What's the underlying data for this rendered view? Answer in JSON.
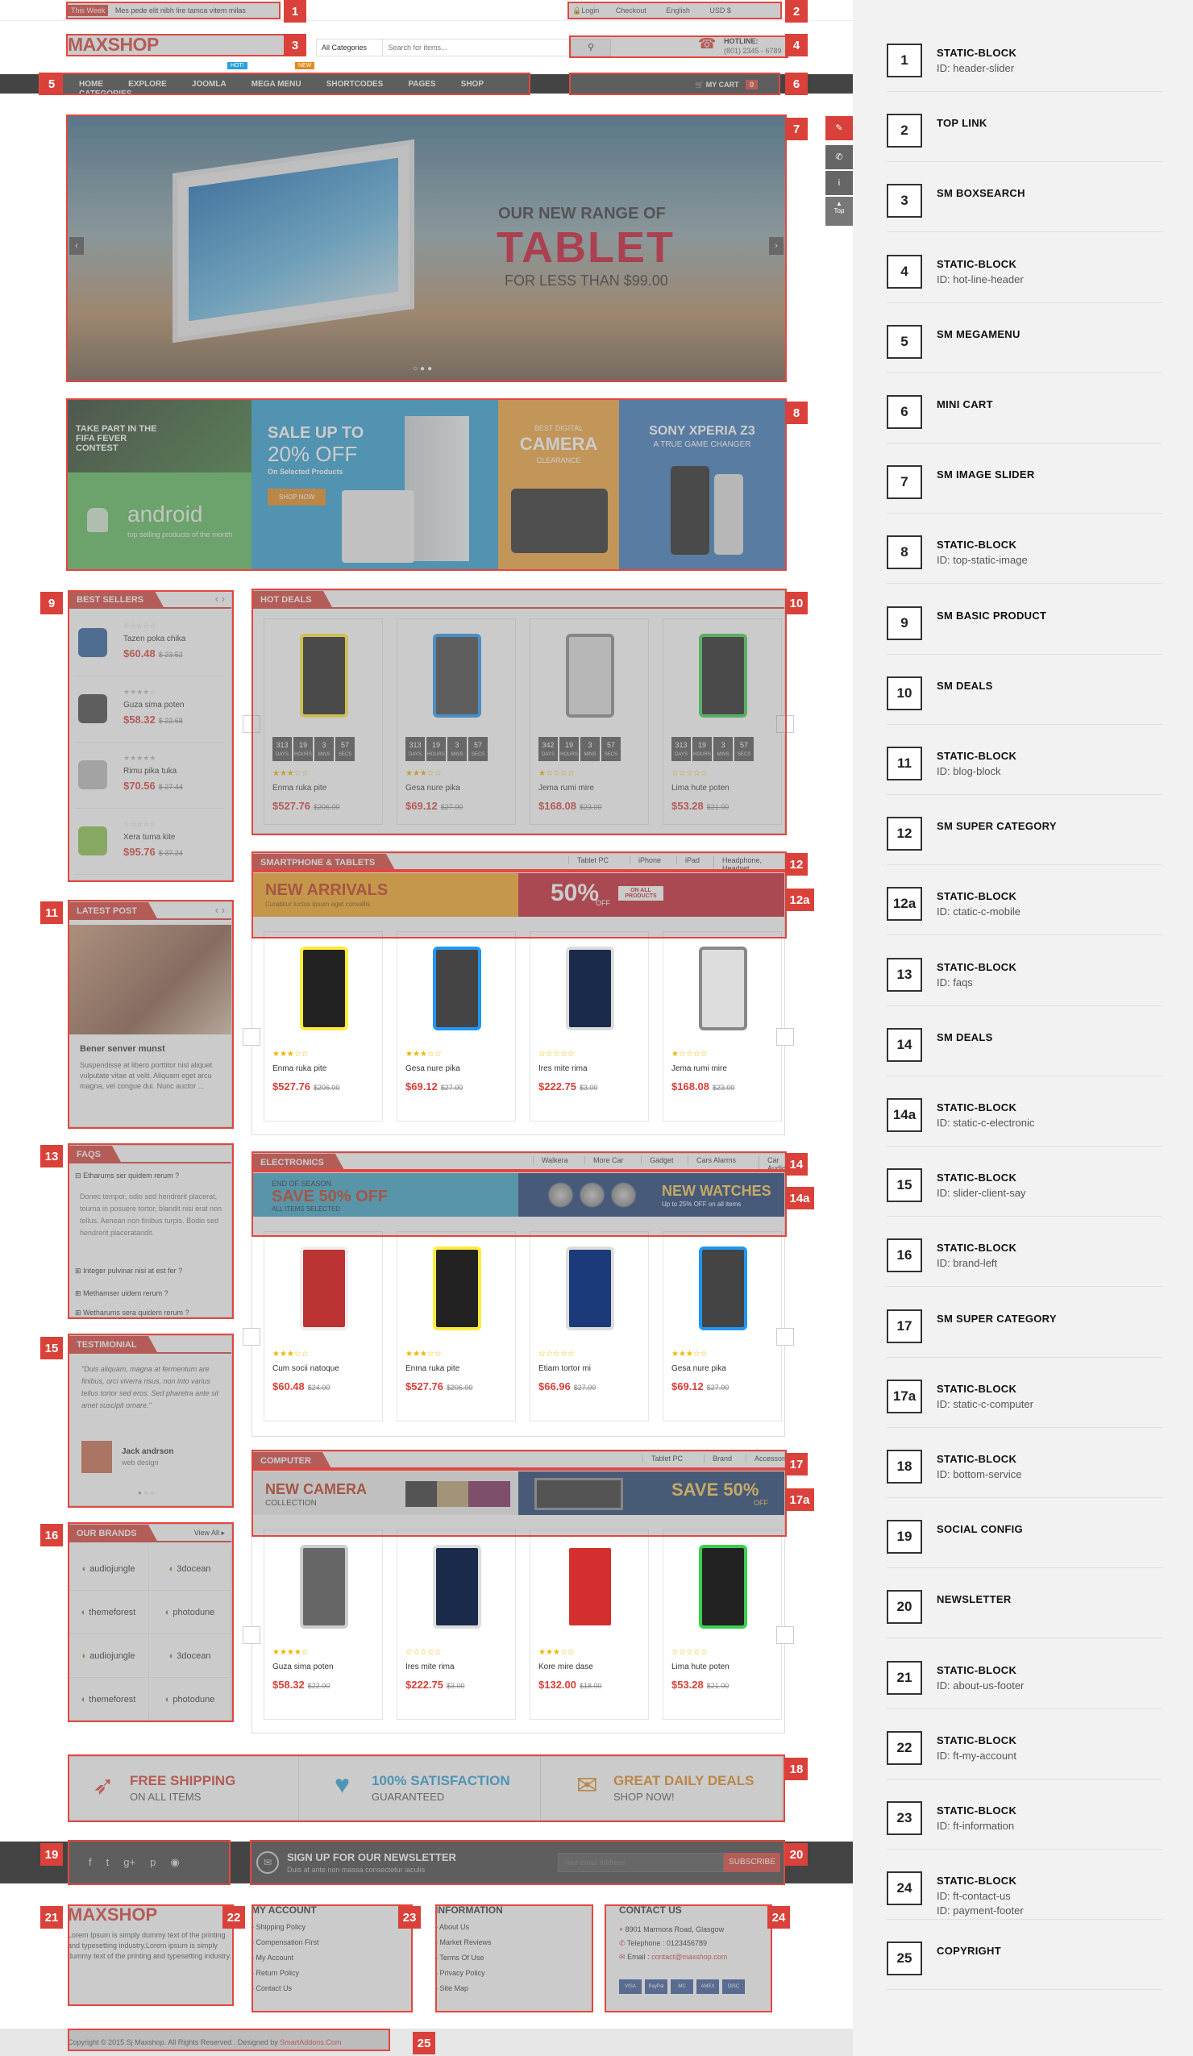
{
  "header": {
    "week_tag": "This Week",
    "week_text": "Mes pede elit nibh lire tamca vitem milas",
    "login": "Login",
    "checkout": "Checkout",
    "language": "English",
    "currency": "USD $",
    "logo": "MAXSHOP",
    "search_cat": "All Categories",
    "search_placeholder": "Search for items...",
    "hotline_label": "HOTLINE:",
    "hotline_number": "(801) 2345 - 6789"
  },
  "menu": {
    "items": [
      "HOME",
      "EXPLORE",
      "JOOMLA",
      "MEGA MENU",
      "SHORTCODES",
      "PAGES",
      "SHOP",
      "CATEGORIES"
    ],
    "hot": "HOT!",
    "new": "NEW",
    "cart": "MY CART",
    "cart_count": "0"
  },
  "slider": {
    "line1": "OUR NEW RANGE OF",
    "line2": "TABLET",
    "line3": "FOR LESS THAN $99.00"
  },
  "banners": {
    "fifa": "TAKE PART IN THE FIFA FEVER CONTEST",
    "android": "android",
    "android_sub": "top selling products of the month",
    "sale1": "SALE UP TO",
    "sale2": "20% OFF",
    "sale3": "On Selected Products",
    "shop_now": "SHOP NOW",
    "cam_top": "BEST DIGITAL",
    "cam": "CAMERA",
    "cam_sub": "CLEARANCE",
    "sony": "SONY XPERIA Z3",
    "sony_sub": "A TRUE GAME CHANGER"
  },
  "best_sellers": {
    "title": "BEST SELLERS",
    "items": [
      {
        "name": "Tazen poka chika",
        "price": "$60.48",
        "old": "$ 23.52",
        "stars": "☆☆☆☆☆"
      },
      {
        "name": "Guza sima poten",
        "price": "$58.32",
        "old": "$ 22.68",
        "stars": "★★★★☆"
      },
      {
        "name": "Rimu pika tuka",
        "price": "$70.56",
        "old": "$ 27.44",
        "stars": "★★★★★"
      },
      {
        "name": "Xera tuma kite",
        "price": "$95.76",
        "old": "$ 37.24",
        "stars": "☆☆☆☆☆"
      }
    ]
  },
  "hot_deals": {
    "title": "HOT DEALS",
    "labels": [
      "DAYS",
      "HOURS",
      "MINS",
      "SECS"
    ],
    "items": [
      {
        "name": "Enma ruka pite",
        "price": "$527.76",
        "old": "$206.00",
        "cd": [
          "313",
          "19",
          "3",
          "57"
        ],
        "stars": "★★★☆☆"
      },
      {
        "name": "Gesa nure pika",
        "price": "$69.12",
        "old": "$27.00",
        "cd": [
          "313",
          "19",
          "3",
          "57"
        ],
        "stars": "★★★☆☆"
      },
      {
        "name": "Jema rumi mire",
        "price": "$168.08",
        "old": "$23.00",
        "cd": [
          "342",
          "19",
          "3",
          "57"
        ],
        "stars": "★☆☆☆☆"
      },
      {
        "name": "Lima hute poten",
        "price": "$53.28",
        "old": "$21.00",
        "cd": [
          "313",
          "19",
          "3",
          "57"
        ],
        "stars": "☆☆☆☆☆"
      }
    ]
  },
  "smartphone": {
    "title": "SMARTPHONE & TABLETS",
    "tabs": [
      "Tablet PC",
      "iPhone",
      "iPad",
      "Headphone, Headset"
    ],
    "banner_left": "NEW ARRIVALS",
    "banner_left_sub": "Curabitur luctus ipsum eget convallis",
    "banner_pct": "50%",
    "banner_off": "OFF",
    "banner_on": "ON ALL PRODUCTS",
    "items": [
      {
        "name": "Enma ruka pite",
        "price": "$527.76",
        "old": "$206.00",
        "stars": "★★★☆☆"
      },
      {
        "name": "Gesa nure pika",
        "price": "$69.12",
        "old": "$27.00",
        "stars": "★★★☆☆"
      },
      {
        "name": "Ires mite rima",
        "price": "$222.75",
        "old": "$3.00",
        "stars": "☆☆☆☆☆"
      },
      {
        "name": "Jema rumi mire",
        "price": "$168.08",
        "old": "$23.00",
        "stars": "★☆☆☆☆"
      }
    ]
  },
  "latest_post": {
    "title": "LATEST POST",
    "post_title": "Bener senver munst",
    "post_text": "Suspendisse at libero porttitor nisl aliquet vulputate vitae at velit. Aliquam eget arcu magna, vel congue dui. Nunc auctor ..."
  },
  "faqs": {
    "title": "FAQS",
    "q1": "Etharums ser quidem rerum ?",
    "a1": "Donec tempor, odio sed hendrerit placerat, tourna in posuere tortor, blandit nisi erat non tellus. Aenean non finibus turpis. Bodio sed hendrerit placeratandit.",
    "q2": "Integer pulvinar nisi at est fer ?",
    "q3": "Methamser uidem rerum ?",
    "q4": "Wetharums sera quidem rerum ?"
  },
  "electronics": {
    "title": "ELECTRONICS",
    "tabs": [
      "Walkera",
      "More Car",
      "Gadget",
      "Cars Alarms",
      "Car Audio"
    ],
    "b1_top": "END OF SEASON",
    "b1_main": "SAVE 50% OFF",
    "b1_sub": "ALL ITEMS SELECTED",
    "b2_main": "NEW WATCHES",
    "b2_sub": "Up to 25% OFF on all items",
    "items": [
      {
        "name": "Cum socii natoque",
        "price": "$60.48",
        "old": "$24.00",
        "stars": "★★★☆☆"
      },
      {
        "name": "Enma ruka pite",
        "price": "$527.76",
        "old": "$206.00",
        "stars": "★★★☆☆"
      },
      {
        "name": "Etiam tortor mi",
        "price": "$66.96",
        "old": "$27.00",
        "stars": "☆☆☆☆☆"
      },
      {
        "name": "Gesa nure pika",
        "price": "$69.12",
        "old": "$27.00",
        "stars": "★★★☆☆"
      }
    ]
  },
  "testimonial": {
    "title": "TESTIMONIAL",
    "quote": "\"Duis aliquam, magna at fermentum are finibus, orci viverra risus, non into varius tellus tortor sed eros. Sed pharetra ante sit amet suscipit ornare.\"",
    "author": "Jack andrson",
    "role": "web design"
  },
  "computer": {
    "title": "COMPUTER",
    "tabs": [
      "Tablet PC",
      "Brand",
      "Accessories"
    ],
    "b1": "NEW CAMERA",
    "b1_sub": "COLLECTION",
    "b2": "SAVE 50%",
    "b2_off": "OFF",
    "items": [
      {
        "name": "Guza sima poten",
        "price": "$58.32",
        "old": "$22.00",
        "stars": "★★★★☆"
      },
      {
        "name": "Ires mite rima",
        "price": "$222.75",
        "old": "$3.00",
        "stars": "☆☆☆☆☆"
      },
      {
        "name": "Kore mire dase",
        "price": "$132.00",
        "old": "$18.00",
        "stars": "★★★☆☆"
      },
      {
        "name": "Lima hute poten",
        "price": "$53.28",
        "old": "$21.00",
        "stars": "☆☆☆☆☆"
      }
    ]
  },
  "brands": {
    "title": "OUR BRANDS",
    "view_all": "View All",
    "items": [
      "audiojungle",
      "3docean",
      "themeforest",
      "photodune",
      "audiojungle",
      "3docean",
      "themeforest",
      "photodune"
    ]
  },
  "service": [
    {
      "title": "FREE SHIPPING",
      "sub": "ON ALL ITEMS",
      "color": "#d8403a"
    },
    {
      "title": "100% SATISFACTION",
      "sub": "GUARANTEED",
      "color": "#2aa0d8"
    },
    {
      "title": "GREAT DAILY DEALS",
      "sub": "SHOP NOW!",
      "color": "#e28a1f"
    }
  ],
  "newsletter": {
    "title": "SIGN UP FOR OUR NEWSLETTER",
    "sub": "Duis at ante non massa consectetur iaculis",
    "placeholder": "Your email address",
    "button": "SUBSCRIBE"
  },
  "footer": {
    "about_logo": "MAXSHOP",
    "about_text": "Lorem Ipsum is simply dummy text of the printing and typesetting industry.Lorem ipsum is simply dummy text of the printing and typesetting industry.",
    "my_account": "MY ACCOUNT",
    "my_account_links": [
      "Shipping Policy",
      "Compensation First",
      "My Account",
      "Return Policy",
      "Contact Us"
    ],
    "information": "INFORMATION",
    "information_links": [
      "About Us",
      "Market Reviews",
      "Terms Of Use",
      "Privacy Policy",
      "Site Map"
    ],
    "contact": "CONTACT US",
    "address": "8901 Marmora Road, Glasgow",
    "phone": "Telephone : 0123456789",
    "email_label": "Email :",
    "email": "contact@maxshop.com",
    "payments": [
      "VISA",
      "PayPal",
      "MC",
      "AMEX",
      "DISC"
    ],
    "copyright": "Copyright © 2015 Sj Maxshop. All Rights Reserved . Designed by",
    "designer": "SmartAddons.Com"
  },
  "tools": {
    "top": "Top"
  },
  "legend": [
    {
      "n": "1",
      "t": "STATIC-BLOCK",
      "s": "ID: header-slider"
    },
    {
      "n": "2",
      "t": "TOP LINK",
      "s": ""
    },
    {
      "n": "3",
      "t": "SM BOXSEARCH",
      "s": ""
    },
    {
      "n": "4",
      "t": "STATIC-BLOCK",
      "s": "ID: hot-line-header"
    },
    {
      "n": "5",
      "t": "SM MEGAMENU",
      "s": ""
    },
    {
      "n": "6",
      "t": "MINI CART",
      "s": ""
    },
    {
      "n": "7",
      "t": "SM IMAGE SLIDER",
      "s": ""
    },
    {
      "n": "8",
      "t": "STATIC-BLOCK",
      "s": "ID: top-static-image"
    },
    {
      "n": "9",
      "t": "SM BASIC PRODUCT",
      "s": ""
    },
    {
      "n": "10",
      "t": "SM DEALS",
      "s": ""
    },
    {
      "n": "11",
      "t": "STATIC-BLOCK",
      "s": "ID: blog-block"
    },
    {
      "n": "12",
      "t": "SM SUPER CATEGORY",
      "s": ""
    },
    {
      "n": "12a",
      "t": "STATIC-BLOCK",
      "s": "ID: ctatic-c-mobile"
    },
    {
      "n": "13",
      "t": "STATIC-BLOCK",
      "s": "ID: faqs"
    },
    {
      "n": "14",
      "t": "SM DEALS",
      "s": ""
    },
    {
      "n": "14a",
      "t": "STATIC-BLOCK",
      "s": "ID: static-c-electronic"
    },
    {
      "n": "15",
      "t": "STATIC-BLOCK",
      "s": "ID: slider-client-say"
    },
    {
      "n": "16",
      "t": "STATIC-BLOCK",
      "s": "ID: brand-left"
    },
    {
      "n": "17",
      "t": "SM SUPER CATEGORY",
      "s": ""
    },
    {
      "n": "17a",
      "t": "STATIC-BLOCK",
      "s": "ID: static-c-computer"
    },
    {
      "n": "18",
      "t": "STATIC-BLOCK",
      "s": "ID: bottom-service"
    },
    {
      "n": "19",
      "t": "SOCIAL CONFIG",
      "s": ""
    },
    {
      "n": "20",
      "t": "NEWSLETTER",
      "s": ""
    },
    {
      "n": "21",
      "t": "STATIC-BLOCK",
      "s": "ID: about-us-footer"
    },
    {
      "n": "22",
      "t": "STATIC-BLOCK",
      "s": "ID: ft-my-account"
    },
    {
      "n": "23",
      "t": "STATIC-BLOCK",
      "s": "ID: ft-information"
    },
    {
      "n": "24",
      "t": "STATIC-BLOCK",
      "s": "ID: ft-contact-us",
      "s2": "ID: payment-footer"
    },
    {
      "n": "25",
      "t": "COPYRIGHT",
      "s": ""
    }
  ],
  "markers": [
    "1",
    "2",
    "3",
    "4",
    "5",
    "6",
    "7",
    "8",
    "9",
    "10",
    "11",
    "12",
    "12a",
    "13",
    "14",
    "14a",
    "15",
    "16",
    "17",
    "17a",
    "18",
    "19",
    "20",
    "21",
    "22",
    "23",
    "24",
    "25"
  ],
  "colors": {
    "accent": "#d8403a",
    "dark_bar": "#444444",
    "sidebar": "#f2f2f2"
  }
}
